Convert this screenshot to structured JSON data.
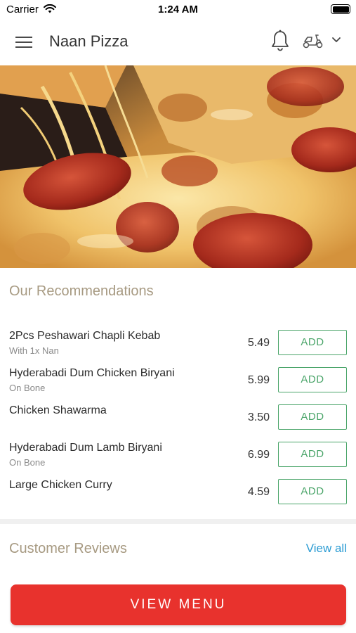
{
  "status_bar": {
    "carrier": "Carrier",
    "time": "1:24 AM"
  },
  "header": {
    "title": "Naan Pizza",
    "icons": [
      "menu-icon",
      "bell-icon",
      "scooter-icon",
      "chevron-down-icon"
    ]
  },
  "hero": {
    "image": "pepperoni-pizza-photo"
  },
  "recommendations": {
    "title": "Our Recommendations",
    "items": [
      {
        "name": "2Pcs Peshawari Chapli Kebab",
        "desc": "With 1x Nan",
        "price": "5.49",
        "action": "ADD"
      },
      {
        "name": "Hyderabadi Dum Chicken Biryani",
        "desc": "On Bone",
        "price": "5.99",
        "action": "ADD"
      },
      {
        "name": "Chicken Shawarma",
        "desc": "",
        "price": "3.50",
        "action": "ADD"
      },
      {
        "name": "Hyderabadi Dum Lamb Biryani",
        "desc": "On Bone",
        "price": "6.99",
        "action": "ADD"
      },
      {
        "name": "Large Chicken Curry",
        "desc": "",
        "price": "4.59",
        "action": "ADD"
      }
    ]
  },
  "reviews": {
    "title": "Customer Reviews",
    "view_all": "View all"
  },
  "cta": {
    "label": "VIEW MENU"
  },
  "colors": {
    "accent_red": "#e8322d",
    "add_green": "#4ba56a",
    "link_blue": "#2a9bd3",
    "section_title": "#a79a82"
  }
}
